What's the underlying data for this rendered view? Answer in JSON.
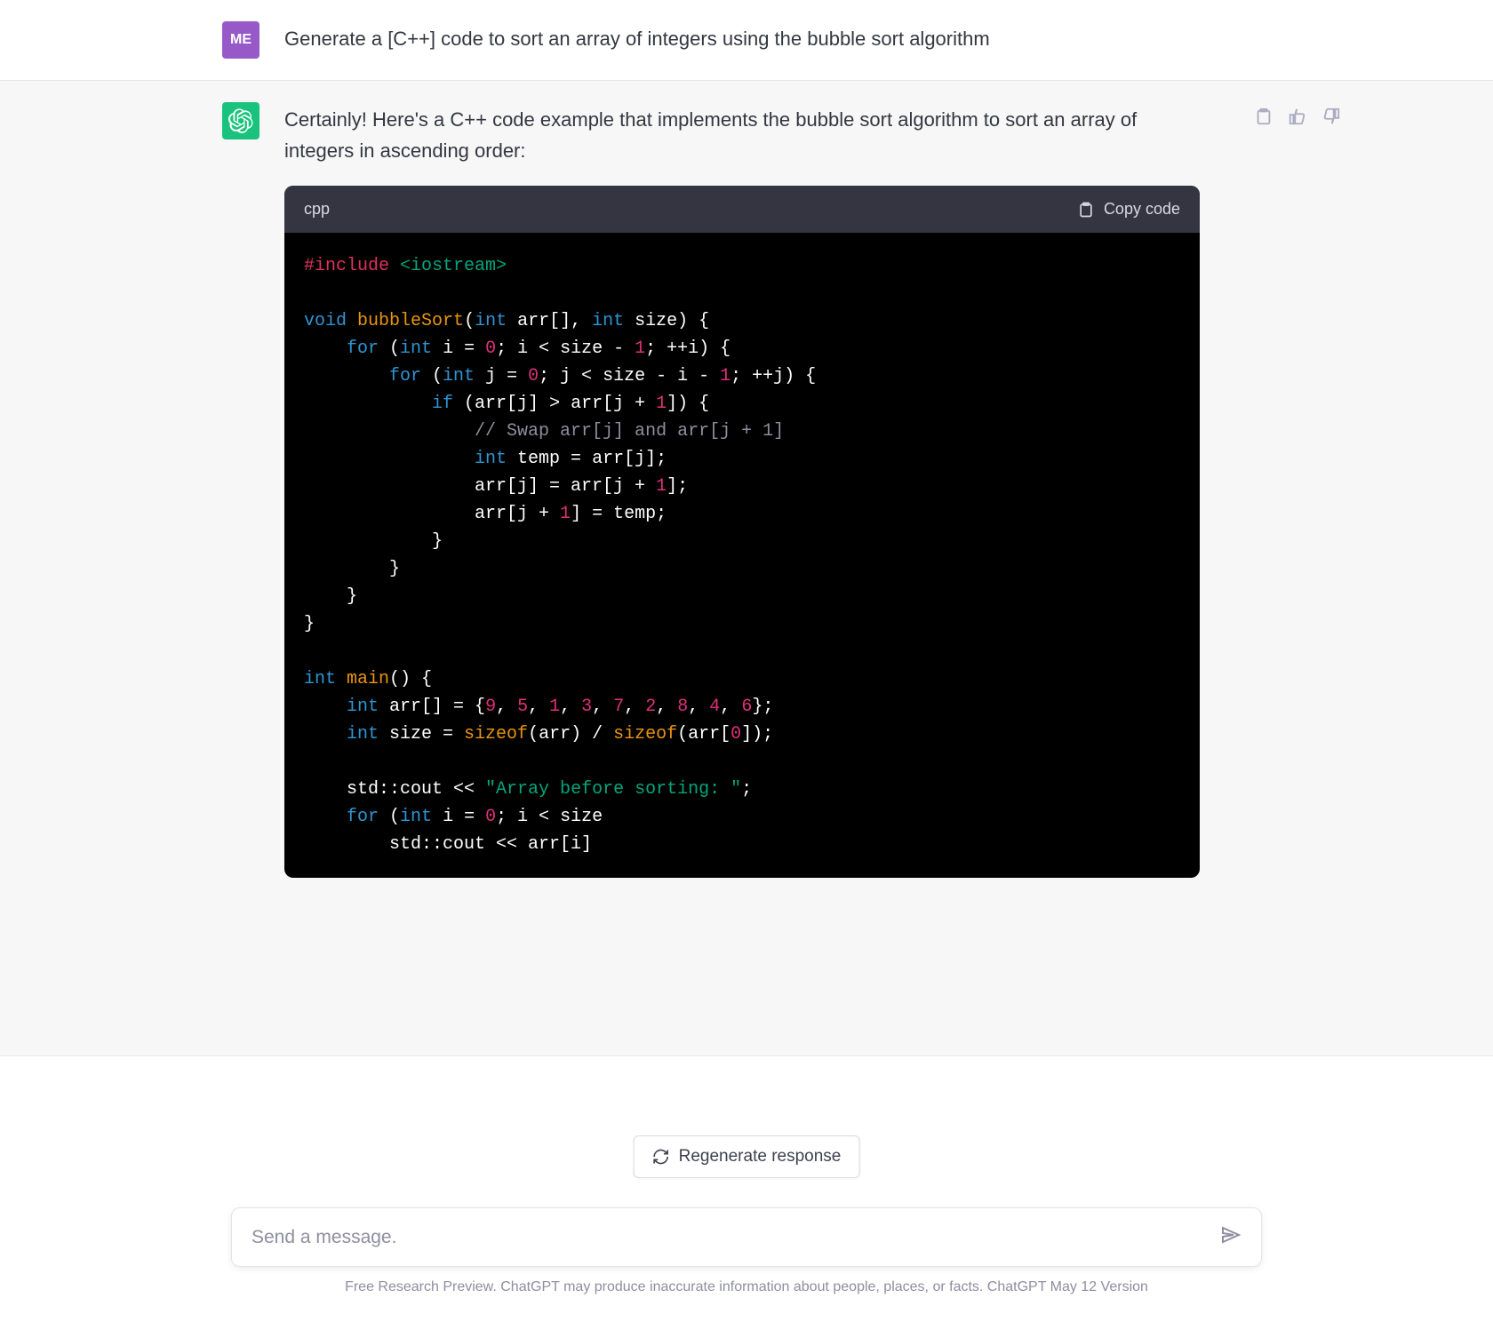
{
  "user": {
    "avatar": "ME",
    "prompt": "Generate a [C++] code to sort an array of integers using the bubble sort algorithm"
  },
  "assistant": {
    "intro": "Certainly! Here's a C++ code example that implements the bubble sort algorithm to sort an array of integers in ascending order:",
    "code_lang": "cpp",
    "copy_label": "Copy code",
    "code_tokens": [
      [
        [
          "tok-pre",
          "#include"
        ],
        [
          "",
          " "
        ],
        [
          "tok-str",
          "<iostream>"
        ]
      ],
      [],
      [
        [
          "tok-kw",
          "void"
        ],
        [
          "",
          " "
        ],
        [
          "tok-call",
          "bubbleSort"
        ],
        [
          "",
          "("
        ],
        [
          "tok-kw",
          "int"
        ],
        [
          "",
          " arr[], "
        ],
        [
          "tok-kw",
          "int"
        ],
        [
          "",
          " size) {"
        ]
      ],
      [
        [
          "",
          "    "
        ],
        [
          "tok-kw",
          "for"
        ],
        [
          "",
          " ("
        ],
        [
          "tok-kw",
          "int"
        ],
        [
          "",
          " i = "
        ],
        [
          "tok-num",
          "0"
        ],
        [
          "",
          "; i < size - "
        ],
        [
          "tok-num",
          "1"
        ],
        [
          "",
          "; ++i) {"
        ]
      ],
      [
        [
          "",
          "        "
        ],
        [
          "tok-kw",
          "for"
        ],
        [
          "",
          " ("
        ],
        [
          "tok-kw",
          "int"
        ],
        [
          "",
          " j = "
        ],
        [
          "tok-num",
          "0"
        ],
        [
          "",
          "; j < size - i - "
        ],
        [
          "tok-num",
          "1"
        ],
        [
          "",
          "; ++j) {"
        ]
      ],
      [
        [
          "",
          "            "
        ],
        [
          "tok-kw",
          "if"
        ],
        [
          "",
          " (arr[j] > arr[j + "
        ],
        [
          "tok-num",
          "1"
        ],
        [
          "",
          "]) {"
        ]
      ],
      [
        [
          "",
          "                "
        ],
        [
          "tok-cmt",
          "// Swap arr[j] and arr[j + 1]"
        ]
      ],
      [
        [
          "",
          "                "
        ],
        [
          "tok-kw",
          "int"
        ],
        [
          "",
          " temp = arr[j];"
        ]
      ],
      [
        [
          "",
          "                arr[j] = arr[j + "
        ],
        [
          "tok-num",
          "1"
        ],
        [
          "",
          "];"
        ]
      ],
      [
        [
          "",
          "                arr[j + "
        ],
        [
          "tok-num",
          "1"
        ],
        [
          "",
          "] = temp;"
        ]
      ],
      [
        [
          "",
          "            }"
        ]
      ],
      [
        [
          "",
          "        }"
        ]
      ],
      [
        [
          "",
          "    }"
        ]
      ],
      [
        [
          "",
          "}"
        ]
      ],
      [],
      [
        [
          "tok-kw",
          "int"
        ],
        [
          "",
          " "
        ],
        [
          "tok-call",
          "main"
        ],
        [
          "",
          "() {"
        ]
      ],
      [
        [
          "",
          "    "
        ],
        [
          "tok-kw",
          "int"
        ],
        [
          "",
          " arr[] = {"
        ],
        [
          "tok-num",
          "9"
        ],
        [
          "",
          ", "
        ],
        [
          "tok-num",
          "5"
        ],
        [
          "",
          ", "
        ],
        [
          "tok-num",
          "1"
        ],
        [
          "",
          ", "
        ],
        [
          "tok-num",
          "3"
        ],
        [
          "",
          ", "
        ],
        [
          "tok-num",
          "7"
        ],
        [
          "",
          ", "
        ],
        [
          "tok-num",
          "2"
        ],
        [
          "",
          ", "
        ],
        [
          "tok-num",
          "8"
        ],
        [
          "",
          ", "
        ],
        [
          "tok-num",
          "4"
        ],
        [
          "",
          ", "
        ],
        [
          "tok-num",
          "6"
        ],
        [
          "",
          "};"
        ]
      ],
      [
        [
          "",
          "    "
        ],
        [
          "tok-kw",
          "int"
        ],
        [
          "",
          " size = "
        ],
        [
          "tok-call",
          "sizeof"
        ],
        [
          "",
          "(arr) / "
        ],
        [
          "tok-call",
          "sizeof"
        ],
        [
          "",
          "(arr["
        ],
        [
          "tok-num",
          "0"
        ],
        [
          "",
          "]);"
        ]
      ],
      [],
      [
        [
          "",
          "    std::cout << "
        ],
        [
          "tok-str",
          "\"Array before sorting: \""
        ],
        [
          "",
          ";"
        ]
      ],
      [
        [
          "",
          "    "
        ],
        [
          "tok-kw",
          "for"
        ],
        [
          "",
          " ("
        ],
        [
          "tok-kw",
          "int"
        ],
        [
          "",
          " i = "
        ],
        [
          "tok-num",
          "0"
        ],
        [
          "",
          "; i < size"
        ]
      ],
      [
        [
          "",
          "        std::cout << arr[i]"
        ]
      ]
    ]
  },
  "regenerate_label": "Regenerate response",
  "input_placeholder": "Send a message.",
  "footer": "Free Research Preview. ChatGPT may produce inaccurate information about people, places, or facts. ChatGPT May 12 Version"
}
